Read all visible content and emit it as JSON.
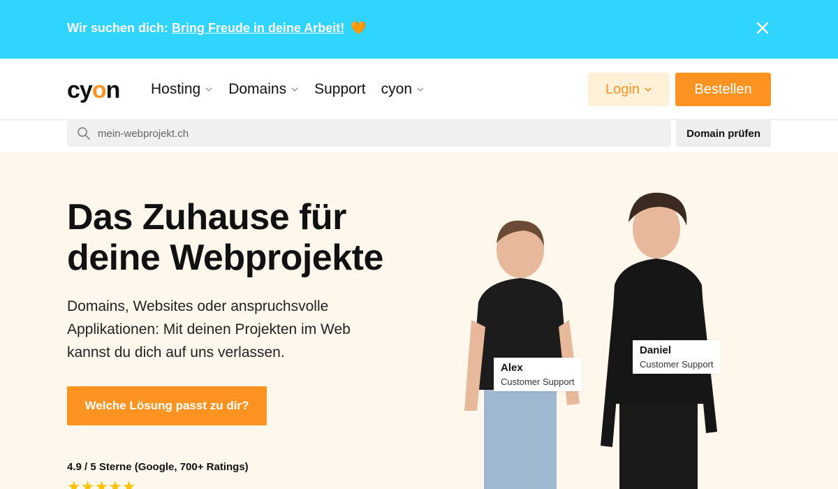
{
  "announcement": {
    "prefix": "Wir suchen dich:",
    "link": "Bring Freude in deine Arbeit!",
    "emoji": "🧡",
    "close_icon": "close-icon"
  },
  "header": {
    "logo": {
      "text_before": "cy",
      "text_o": "o",
      "text_after": "n"
    },
    "nav": [
      {
        "label": "Hosting",
        "has_dropdown": true
      },
      {
        "label": "Domains",
        "has_dropdown": true
      },
      {
        "label": "Support",
        "has_dropdown": false
      },
      {
        "label": "cyon",
        "has_dropdown": true
      }
    ],
    "login_label": "Login",
    "order_label": "Bestellen"
  },
  "domain_search": {
    "placeholder": "mein-webprojekt.ch",
    "button_label": "Domain prüfen"
  },
  "hero": {
    "title_line1": "Das Zuhause für",
    "title_line2": "deine Webprojekte",
    "description": "Domains, Websites oder anspruchsvolle Applikationen: Mit deinen Projekten im Web kannst du dich auf uns verlassen.",
    "cta_label": "Welche Lösung passt zu dir?",
    "rating_text": "4.9 / 5 Sterne (Google, 700+ Ratings)",
    "stars": "★★★★★",
    "star_rating": 5
  },
  "team": [
    {
      "name": "Alex",
      "role": "Customer Support"
    },
    {
      "name": "Daniel",
      "role": "Customer Support"
    }
  ],
  "colors": {
    "announce_bg": "#30d5ff",
    "accent": "#ff9322",
    "hero_bg": "#fff6ec",
    "login_bg": "#fff0d8"
  }
}
